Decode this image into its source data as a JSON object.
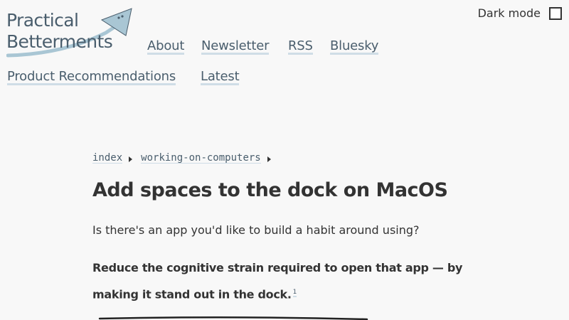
{
  "site": {
    "logo_line1": "Practical",
    "logo_line2": "Betterments"
  },
  "nav": {
    "items": [
      {
        "label": "About"
      },
      {
        "label": "Newsletter"
      },
      {
        "label": "RSS"
      },
      {
        "label": "Bluesky"
      },
      {
        "label": "Product Recommendations"
      },
      {
        "label": "Latest"
      }
    ]
  },
  "dark_mode": {
    "label": "Dark mode",
    "checked": false
  },
  "breadcrumb": {
    "items": [
      {
        "label": "index"
      },
      {
        "label": "working-on-computers"
      }
    ]
  },
  "article": {
    "title": "Add spaces to the dock on MacOS",
    "intro": "Is there's an app you'd like to build a habit around using?",
    "bold_text": "Reduce the cognitive strain required to open that app — by making it stand out in the dock.",
    "footnote_ref": "1"
  },
  "colors": {
    "link": "#4a5e6d",
    "link_underline": "#cfdde6",
    "logo_arrow": "#a9c6d4",
    "background": "#f8f8f8",
    "text": "#333333"
  },
  "icons": {
    "logo": "arrow-rocket-icon",
    "breadcrumb_separator": "caret-right-icon",
    "dark_mode": "checkbox-icon"
  }
}
